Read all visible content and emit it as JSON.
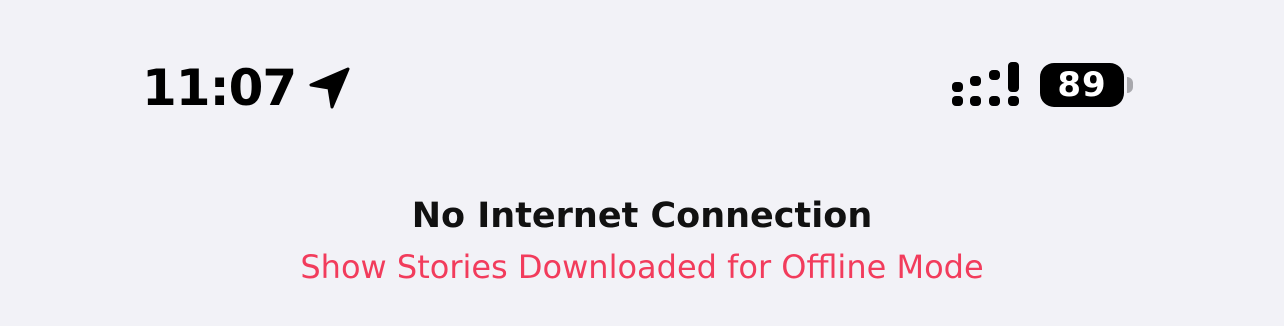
{
  "status_bar": {
    "time": "11:07",
    "battery_level": "89",
    "icons": {
      "location": "location-arrow-icon",
      "signal": "cellular-signal-icon",
      "battery": "battery-icon"
    }
  },
  "banner": {
    "title": "No Internet Connection",
    "link": "Show Stories Downloaded for Offline Mode"
  },
  "colors": {
    "background": "#f2f2f7",
    "accent": "#f23c5c",
    "text": "#111111"
  }
}
